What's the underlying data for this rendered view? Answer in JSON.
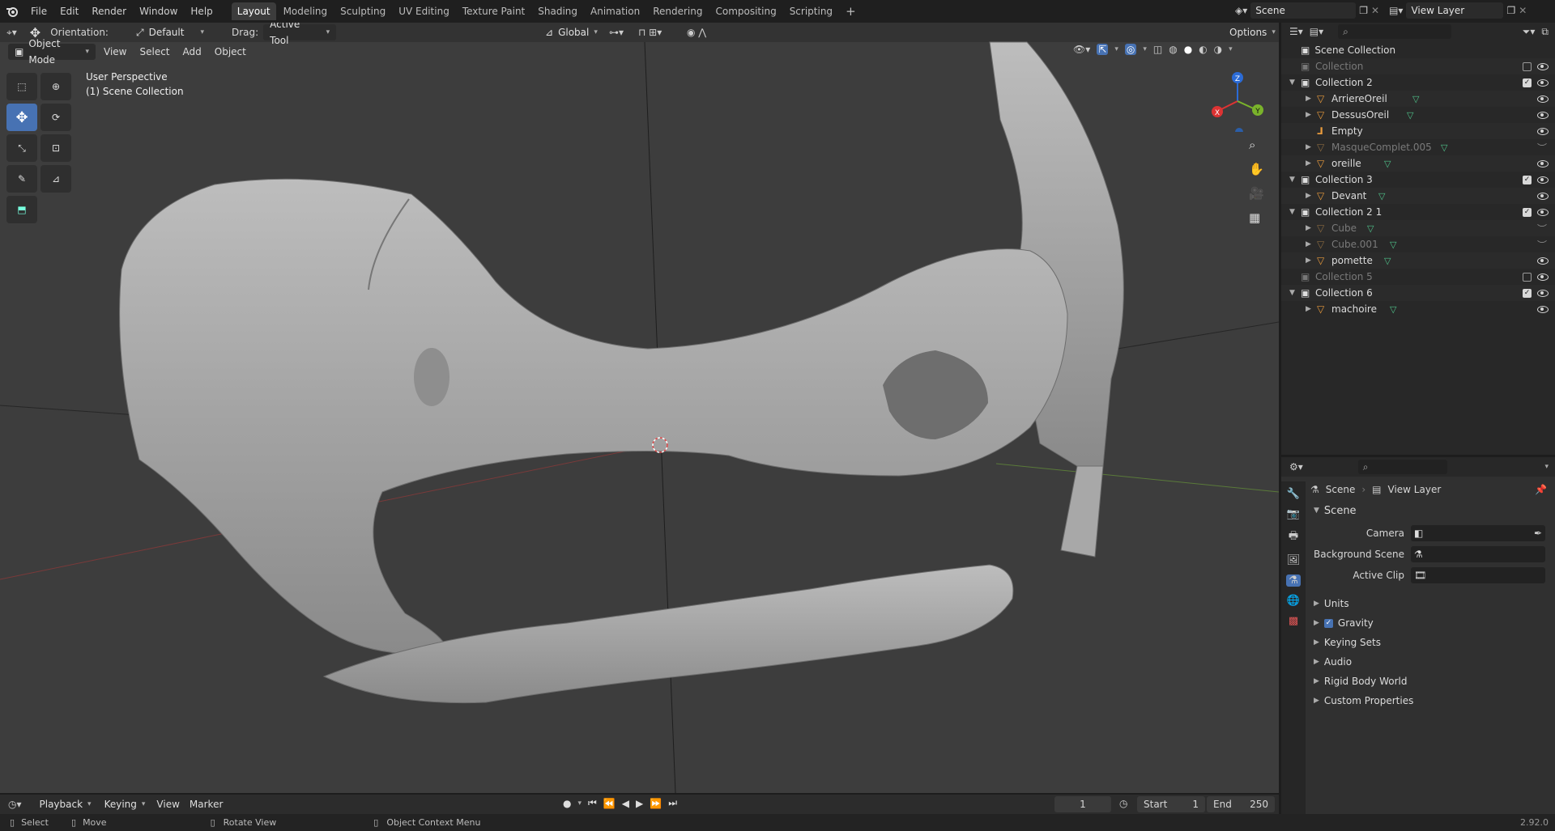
{
  "menu": [
    "File",
    "Edit",
    "Render",
    "Window",
    "Help"
  ],
  "workspaces": [
    "Layout",
    "Modeling",
    "Sculpting",
    "UV Editing",
    "Texture Paint",
    "Shading",
    "Animation",
    "Rendering",
    "Compositing",
    "Scripting"
  ],
  "scene_name": "Scene",
  "view_layer_name": "View Layer",
  "tool_header": {
    "orientation_label": "Orientation:",
    "orientation_value": "Default",
    "drag_label": "Drag:",
    "drag_value": "Active Tool",
    "transform_orientation": "Global",
    "options_label": "Options"
  },
  "viewport_header": {
    "mode": "Object Mode",
    "menus": [
      "View",
      "Select",
      "Add",
      "Object"
    ]
  },
  "viewport_overlay": {
    "perspective": "User Perspective",
    "collection": "(1) Scene Collection"
  },
  "gizmo_axes": {
    "x": "X",
    "y": "Y",
    "z": "Z"
  },
  "outliner": {
    "root": "Scene Collection",
    "rows": [
      {
        "name": "Collection",
        "type": "collection",
        "dim": true
      },
      {
        "name": "Collection 2",
        "type": "collection"
      },
      {
        "name": "ArriereOreil",
        "type": "mesh"
      },
      {
        "name": "DessusOreil",
        "type": "mesh"
      },
      {
        "name": "Empty",
        "type": "empty"
      },
      {
        "name": "MasqueComplet.005",
        "type": "mesh",
        "dim": true
      },
      {
        "name": "oreille",
        "type": "mesh"
      },
      {
        "name": "Collection 3",
        "type": "collection"
      },
      {
        "name": "Devant",
        "type": "mesh"
      },
      {
        "name": "Collection 2 1",
        "type": "collection"
      },
      {
        "name": "Cube",
        "type": "mesh",
        "dim": true
      },
      {
        "name": "Cube.001",
        "type": "mesh",
        "dim": true
      },
      {
        "name": "pomette",
        "type": "mesh"
      },
      {
        "name": "Collection 5",
        "type": "collection",
        "dim": true
      },
      {
        "name": "Collection 6",
        "type": "collection"
      },
      {
        "name": "machoire",
        "type": "mesh"
      }
    ]
  },
  "properties": {
    "breadcrumb_scene": "Scene",
    "breadcrumb_view_layer": "View Layer",
    "section_title": "Scene",
    "camera_label": "Camera",
    "background_scene_label": "Background Scene",
    "active_clip_label": "Active Clip",
    "panels": [
      "Units",
      "Gravity",
      "Keying Sets",
      "Audio",
      "Rigid Body World",
      "Custom Properties"
    ],
    "gravity_enabled": true
  },
  "timeline": {
    "menus": [
      "Playback",
      "Keying",
      "View",
      "Marker"
    ],
    "current_frame": "1",
    "start_label": "Start",
    "start_value": "1",
    "end_label": "End",
    "end_value": "250"
  },
  "statusbar": {
    "select": "Select",
    "move": "Move",
    "rotate": "Rotate View",
    "context": "Object Context Menu",
    "version": "2.92.0"
  },
  "colors": {
    "accent": "#4772b3",
    "viewport_bg": "#3d3d3d",
    "object_orange": "#e89a3c",
    "mesh_data_green": "#4fc28a"
  }
}
